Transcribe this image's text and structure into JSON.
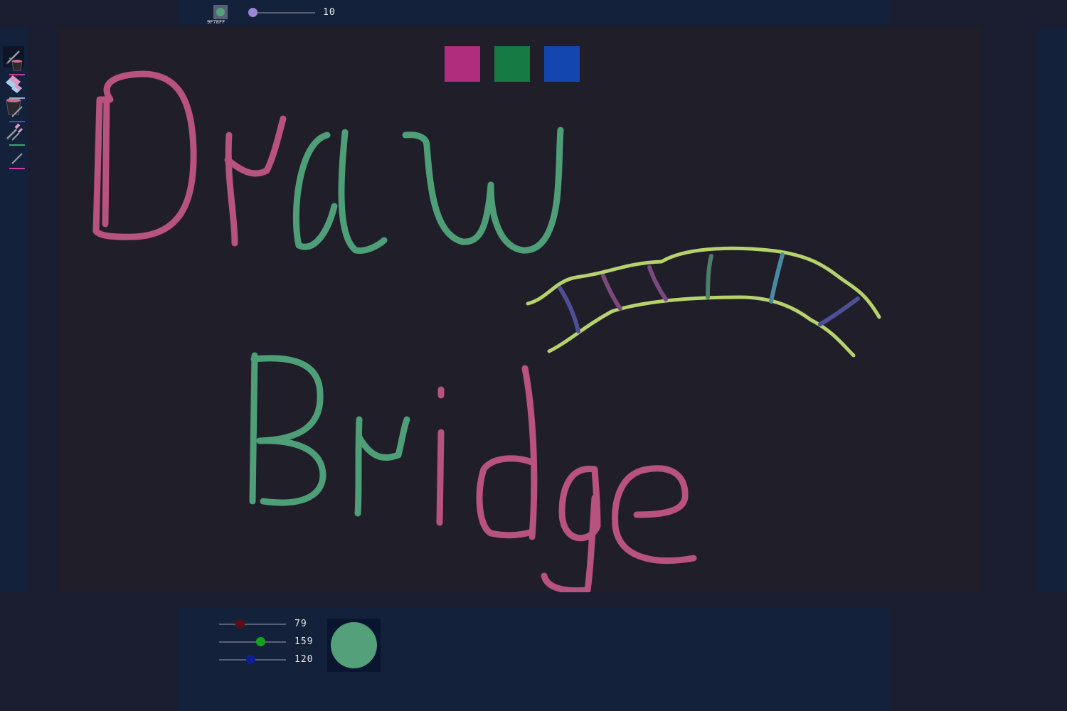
{
  "brush": {
    "hex_label": "9F78FF",
    "size": "10",
    "size_fraction": 0.05,
    "chip_color": "#54a07a"
  },
  "palette": [
    {
      "name": "magenta",
      "color": "#b02c7c"
    },
    {
      "name": "green",
      "color": "#167a44"
    },
    {
      "name": "blue",
      "color": "#1446b0"
    }
  ],
  "tools": [
    {
      "name": "pencil",
      "icon": "pencil-icon",
      "active": true
    },
    {
      "name": "eraser",
      "icon": "eraser-icon",
      "active": false
    },
    {
      "name": "fill",
      "icon": "bucket-icon",
      "active": false
    },
    {
      "name": "eyedropper",
      "icon": "eyedropper-icon",
      "active": false
    }
  ],
  "history": [
    {
      "icon": "bucket-icon",
      "color": "#c23aa0"
    },
    {
      "icon": "eraser-icon",
      "color": "#9aa8d0"
    },
    {
      "icon": "pencil-icon",
      "color": "#3a4fe0"
    },
    {
      "icon": "eyedropper-icon",
      "color": "#2fa876"
    },
    {
      "icon": "pencil-icon",
      "color": "#d23aa8"
    }
  ],
  "rgb": {
    "r": "79",
    "g": "159",
    "b": "120",
    "r_fraction": 0.31,
    "g_fraction": 0.62,
    "b_fraction": 0.47,
    "r_knob": "#5a0e16",
    "g_knob": "#13a31f",
    "b_knob": "#0d1f9a"
  },
  "preview_color": "#54a07a",
  "drawing": {
    "colors": {
      "pink": "#b8527e",
      "teal": "#4e9e78",
      "lime": "#b7d26c",
      "indigo": "#4f4f96",
      "plum": "#7a4a7c",
      "steel": "#4a8aa0",
      "sage": "#4c7e6a"
    }
  }
}
